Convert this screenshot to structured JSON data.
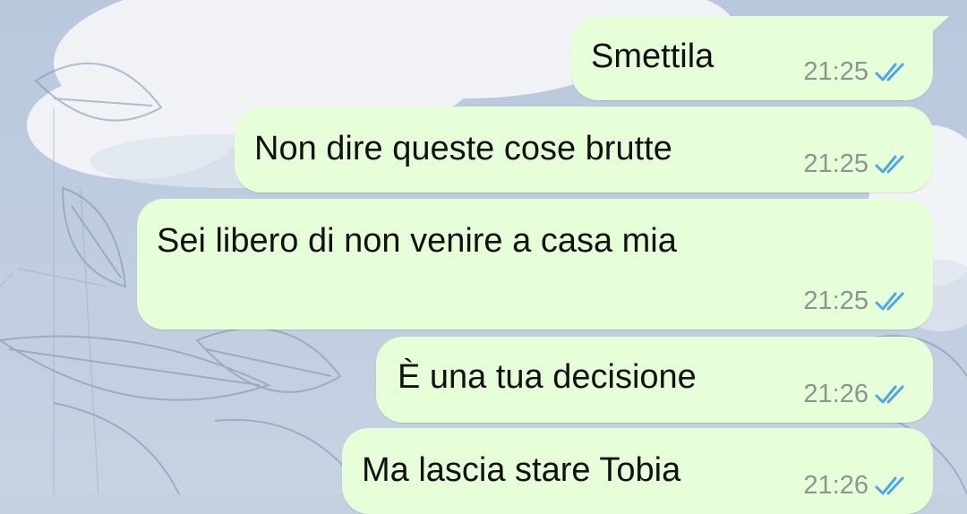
{
  "messages": [
    {
      "text": "Smettila",
      "time": "21:25",
      "status_icon": "double-check-read-icon"
    },
    {
      "text": "Non dire queste cose brutte",
      "time": "21:25",
      "status_icon": "double-check-read-icon"
    },
    {
      "text": "Sei libero di non venire a casa mia",
      "time": "21:25",
      "status_icon": "double-check-read-icon"
    },
    {
      "text": "È una tua decisione",
      "time": "21:26",
      "status_icon": "double-check-read-icon"
    },
    {
      "text": "Ma lascia stare Tobia",
      "time": "21:26",
      "status_icon": "double-check-read-icon"
    }
  ],
  "colors": {
    "bubble": "#e6ffd9",
    "time": "#8c978c",
    "ticks": "#4fa6e3",
    "text": "#111111"
  }
}
